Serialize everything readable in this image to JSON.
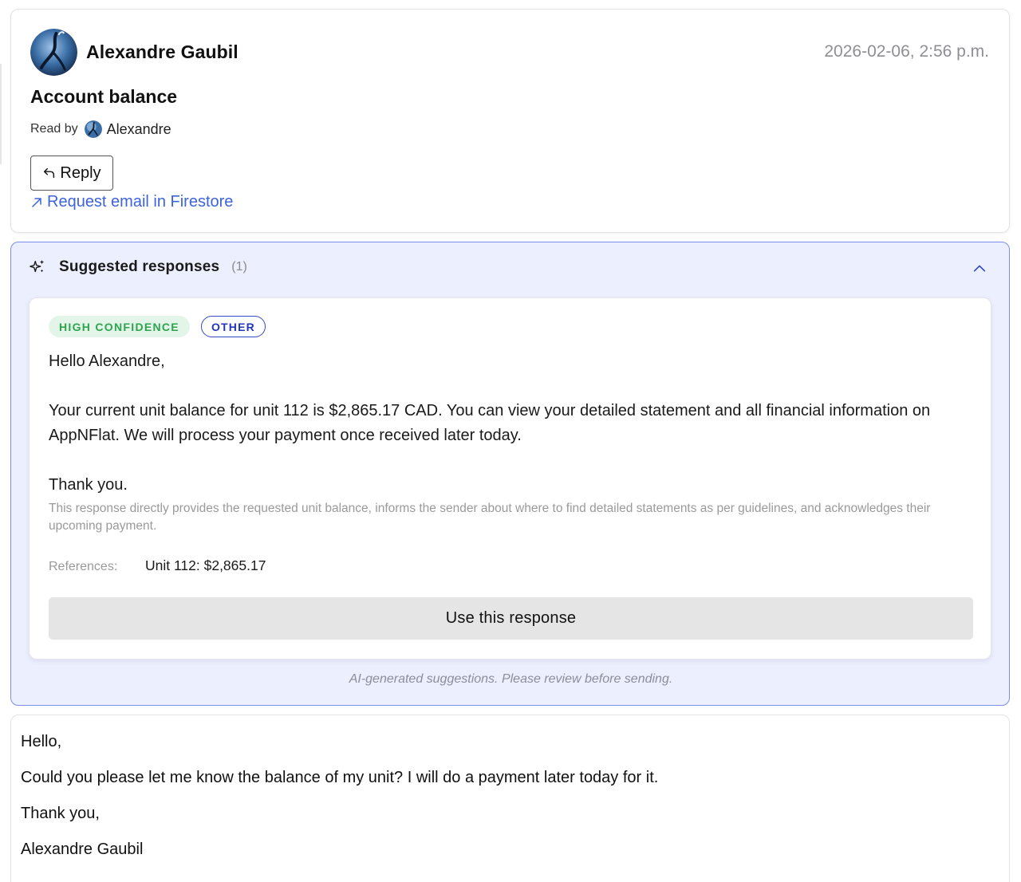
{
  "header": {
    "sender_name": "Alexandre Gaubil",
    "timestamp": "2026-02-06, 2:56 p.m.",
    "subject": "Account balance",
    "read_by_label": "Read by",
    "read_by_name": "Alexandre",
    "reply_label": "Reply",
    "firestore_link_label": "Request email in Firestore"
  },
  "suggestions": {
    "title": "Suggested responses",
    "count": "(1)",
    "items": [
      {
        "confidence_badge": "HIGH CONFIDENCE",
        "category_badge": "OTHER",
        "greeting": "Hello Alexandre,",
        "body": "Your current unit balance for unit 112 is $2,865.17 CAD. You can view your detailed statement and all financial information on AppNFlat. We will process your payment once received later today.",
        "closing": "Thank you.",
        "rationale": "This response directly provides the requested unit balance, informs the sender about where to find detailed statements as per guidelines, and acknowledges their upcoming payment.",
        "references_label": "References:",
        "references_value": "Unit 112: $2,865.17",
        "use_button_label": "Use this response"
      }
    ],
    "disclaimer": "AI-generated suggestions. Please review before sending."
  },
  "email": {
    "lines": [
      "Hello,",
      "Could you please let me know the balance of my unit? I will do a payment later today for it.",
      "Thank you,",
      "Alexandre Gaubil"
    ]
  },
  "colors": {
    "link": "#3d63dd",
    "panel_bg": "#eceffd",
    "panel_border": "#7c8fe8",
    "high_confidence_text": "#2ea44f",
    "high_confidence_bg": "#e3f5e8",
    "other_badge": "#2436b8"
  },
  "icons": {
    "avatar": "avatar-image",
    "reply": "reply-arrow-icon",
    "link": "arrow-up-right-icon",
    "suggest": "sparkles-icon",
    "collapse": "chevron-up-icon"
  }
}
